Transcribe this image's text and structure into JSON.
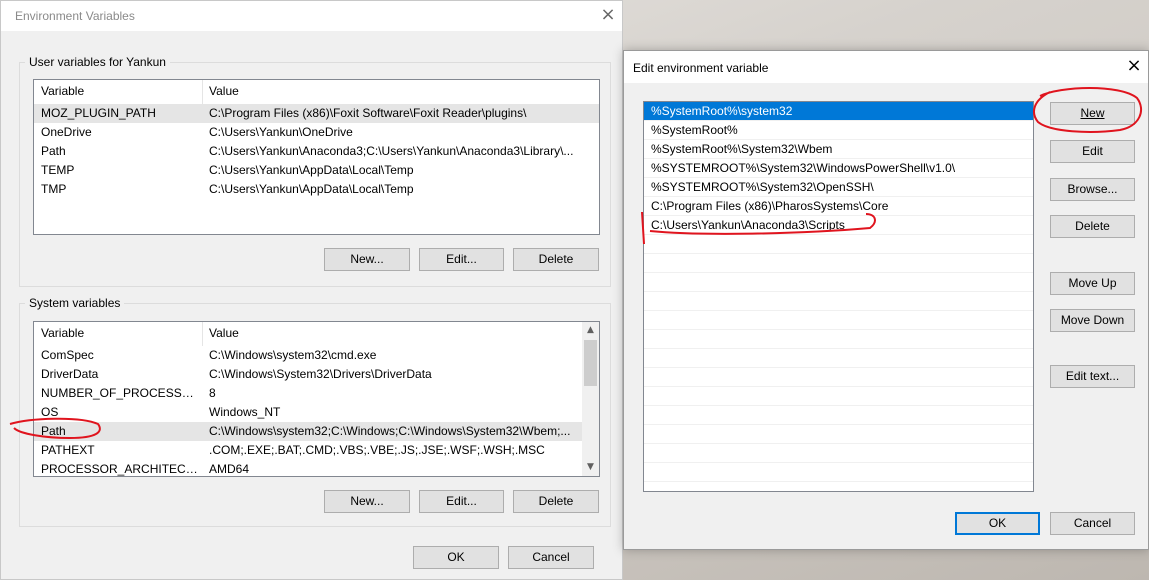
{
  "env": {
    "title": "Environment Variables",
    "user_group_label": "User variables for Yankun",
    "system_group_label": "System variables",
    "col_variable": "Variable",
    "col_value": "Value",
    "user_vars": [
      {
        "name": "MOZ_PLUGIN_PATH",
        "value": "C:\\Program Files (x86)\\Foxit Software\\Foxit Reader\\plugins\\"
      },
      {
        "name": "OneDrive",
        "value": "C:\\Users\\Yankun\\OneDrive"
      },
      {
        "name": "Path",
        "value": "C:\\Users\\Yankun\\Anaconda3;C:\\Users\\Yankun\\Anaconda3\\Library\\..."
      },
      {
        "name": "TEMP",
        "value": "C:\\Users\\Yankun\\AppData\\Local\\Temp"
      },
      {
        "name": "TMP",
        "value": "C:\\Users\\Yankun\\AppData\\Local\\Temp"
      }
    ],
    "system_vars": [
      {
        "name": "ComSpec",
        "value": "C:\\Windows\\system32\\cmd.exe"
      },
      {
        "name": "DriverData",
        "value": "C:\\Windows\\System32\\Drivers\\DriverData"
      },
      {
        "name": "NUMBER_OF_PROCESSORS",
        "value": "8"
      },
      {
        "name": "OS",
        "value": "Windows_NT"
      },
      {
        "name": "Path",
        "value": "C:\\Windows\\system32;C:\\Windows;C:\\Windows\\System32\\Wbem;..."
      },
      {
        "name": "PATHEXT",
        "value": ".COM;.EXE;.BAT;.CMD;.VBS;.VBE;.JS;.JSE;.WSF;.WSH;.MSC"
      },
      {
        "name": "PROCESSOR_ARCHITECTURE",
        "value": "AMD64"
      }
    ],
    "buttons": {
      "new": "New...",
      "edit": "Edit...",
      "delete": "Delete",
      "ok": "OK",
      "cancel": "Cancel"
    }
  },
  "edit": {
    "title": "Edit environment variable",
    "paths": [
      "%SystemRoot%\\system32",
      "%SystemRoot%",
      "%SystemRoot%\\System32\\Wbem",
      "%SYSTEMROOT%\\System32\\WindowsPowerShell\\v1.0\\",
      "%SYSTEMROOT%\\System32\\OpenSSH\\",
      "C:\\Program Files (x86)\\PharosSystems\\Core",
      "C:\\Users\\Yankun\\Anaconda3\\Scripts"
    ],
    "buttons": {
      "new": "New",
      "edit": "Edit",
      "browse": "Browse...",
      "delete": "Delete",
      "move_up": "Move Up",
      "move_down": "Move Down",
      "edit_text": "Edit text...",
      "ok": "OK",
      "cancel": "Cancel"
    }
  },
  "colors": {
    "selection": "#0078d7",
    "annotation": "#e0141e"
  }
}
